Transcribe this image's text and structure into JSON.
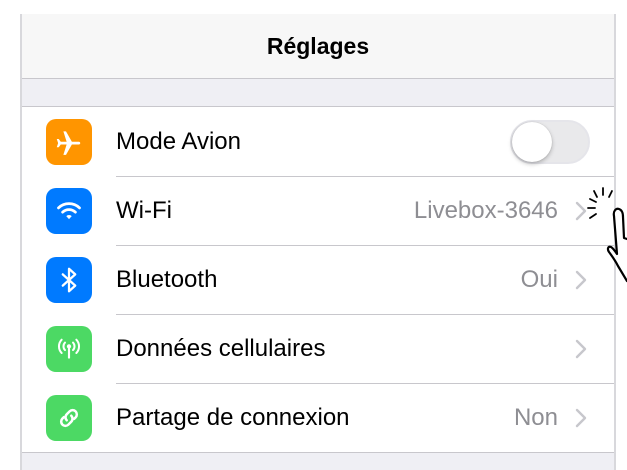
{
  "navbar": {
    "title": "Réglages"
  },
  "settings": {
    "rows": [
      {
        "label": "Mode Avion",
        "icon": "airplane-icon",
        "icon_color": "#ff9500",
        "toggle_on": false
      },
      {
        "label": "Wi-Fi",
        "icon": "wifi-icon",
        "icon_color": "#007aff",
        "value": "Livebox-3646"
      },
      {
        "label": "Bluetooth",
        "icon": "bluetooth-icon",
        "icon_color": "#007aff",
        "value": "Oui"
      },
      {
        "label": "Données cellulaires",
        "icon": "cellular-antenna-icon",
        "icon_color": "#4cd964",
        "value": ""
      },
      {
        "label": "Partage de connexion",
        "icon": "link-chain-icon",
        "icon_color": "#4cd964",
        "value": "Non"
      }
    ]
  },
  "overlay": {
    "hand_icon": "pointing-hand-tap-icon"
  }
}
